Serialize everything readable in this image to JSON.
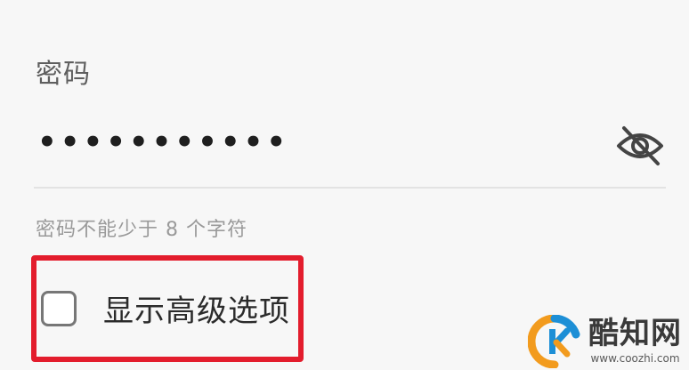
{
  "password_section": {
    "label": "密码",
    "masked_value": "•••••••••••",
    "toggle_icon": "eye-slash-icon",
    "hint": "密码不能少于 8 个字符"
  },
  "advanced": {
    "checked": false,
    "label": "显示高级选项",
    "highlight_color": "#e31d2d"
  },
  "watermark": {
    "name": "酷知网",
    "url": "www.coozhi.com",
    "logo_colors": [
      "#f29b1e",
      "#1d8fd6"
    ]
  }
}
